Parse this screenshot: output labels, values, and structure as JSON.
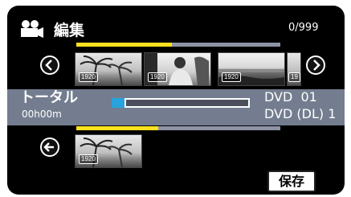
{
  "header": {
    "title": "編集",
    "counter": "0/999"
  },
  "scene_strip": {
    "thumbnails": [
      {
        "resolution": "1920"
      },
      {
        "resolution": "1920"
      },
      {
        "resolution": "1920"
      },
      {
        "resolution": "19"
      }
    ]
  },
  "total": {
    "label": "トータル",
    "time": "00h00m",
    "dvd_label": "DVD",
    "dvd_count": "01",
    "dvd_dl_label": "DVD (DL)",
    "dvd_dl_count": "1"
  },
  "selected_strip": {
    "thumbnails": [
      {
        "resolution": "1920"
      }
    ]
  },
  "actions": {
    "save_label": "保存"
  },
  "colors": {
    "screen_bg": "#000000",
    "band": "#737d8f",
    "progress_yellow": "#ffe11f",
    "capacity_blue": "#29a3dc"
  }
}
